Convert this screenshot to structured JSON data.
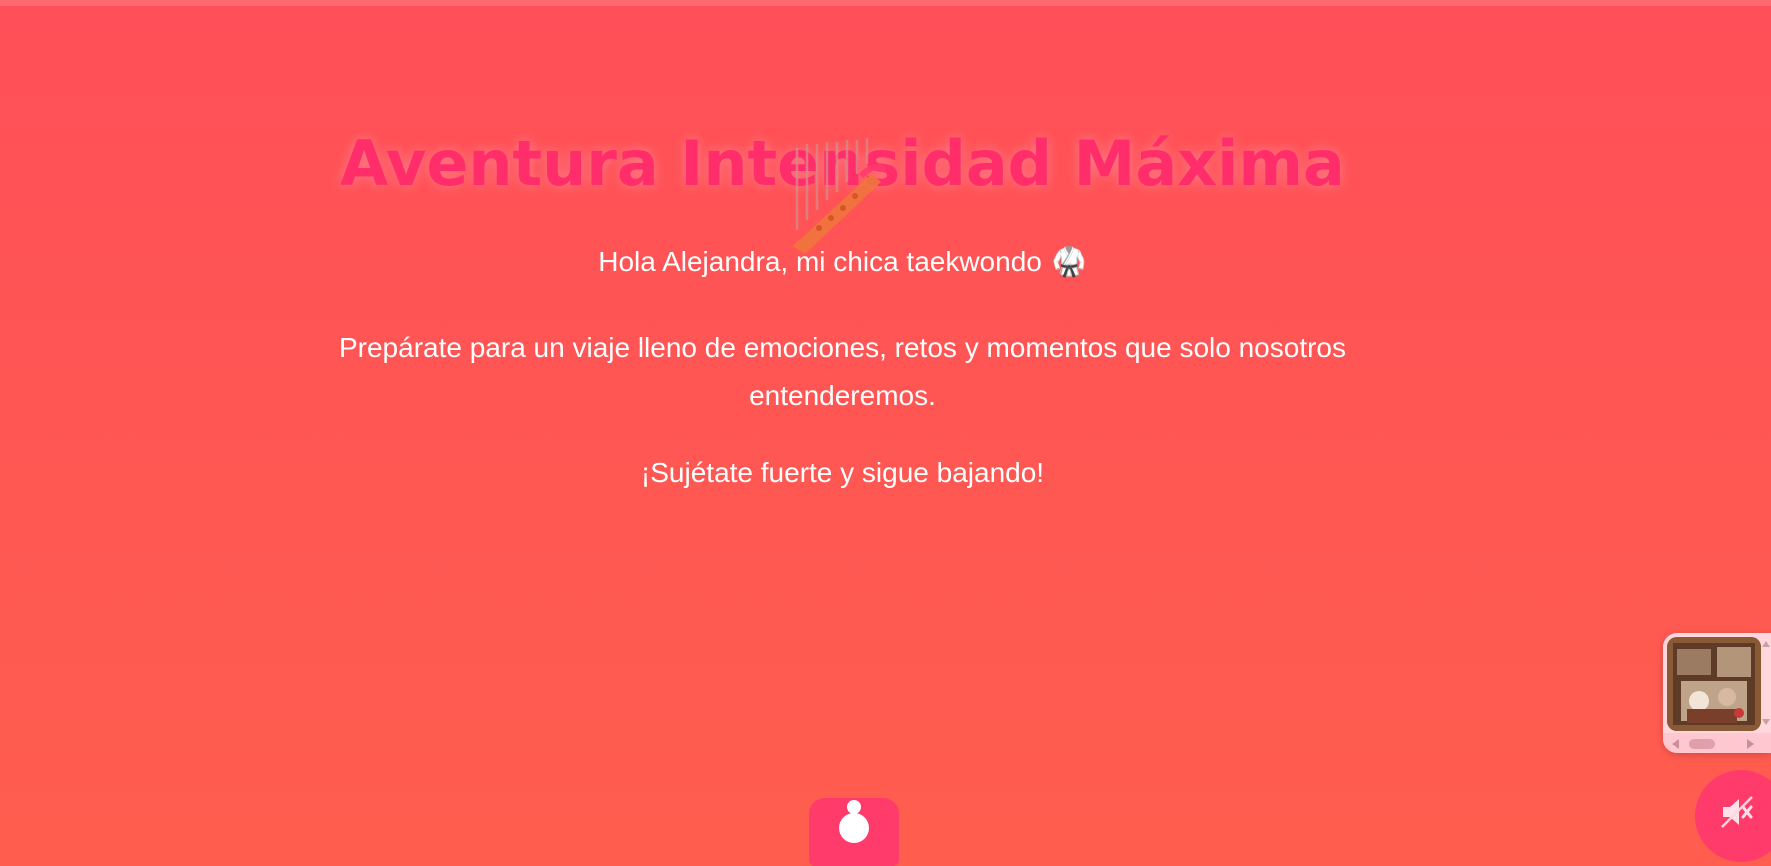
{
  "hero": {
    "title": "Aventura Intensidad Máxima",
    "greeting": "Hola Alejandra, mi chica taekwondo",
    "greeting_emoji": "🥋",
    "intro": "Prepárate para un viaje lleno de emociones, retos y momentos que solo nosotros entenderemos.",
    "call_to_action": "¡Sujétate fuerte y sigue bajando!",
    "decoration_icon": "harp-icon"
  },
  "controls": {
    "scroll_down_icon": "person-icon",
    "sound_toggle_icon": "speaker-muted-icon",
    "sound_state": "muted"
  },
  "music_widget": {
    "cover_icon": "album-cover",
    "prev_icon": "triangle-left-icon",
    "next_icon": "triangle-right-icon"
  },
  "colors": {
    "background_top": "#ff4f58",
    "background_bottom": "#ff5e4e",
    "accent": "#ff3b6b",
    "title": "#ff2e6a",
    "text": "#ffffff",
    "widget_bg": "#ffd7dc"
  }
}
